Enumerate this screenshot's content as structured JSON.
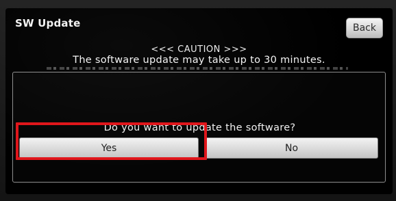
{
  "header": {
    "title": "SW Update",
    "back_label": "Back"
  },
  "caution": {
    "heading": "<<< CAUTION >>>",
    "line1": "The software update may take up to 30 minutes."
  },
  "dialog": {
    "question": "Do you want to update the software?",
    "yes_label": "Yes",
    "no_label": "No"
  },
  "annotation": {
    "highlight_color": "#e0161b"
  }
}
